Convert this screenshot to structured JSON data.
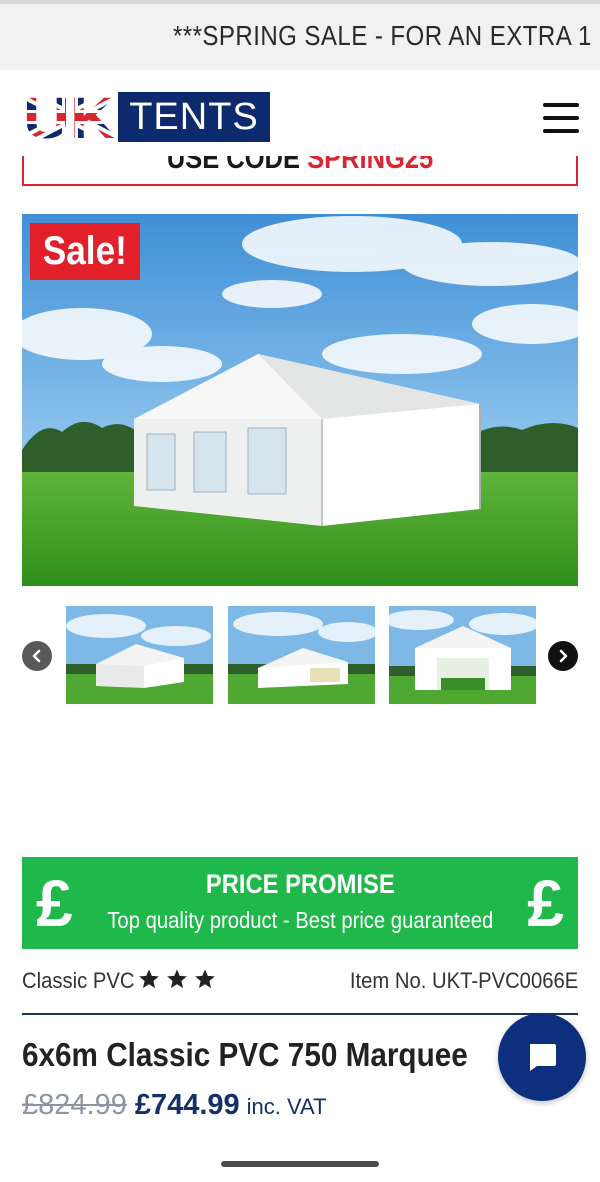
{
  "banner": {
    "text": "***SPRING SALE - FOR AN EXTRA 1"
  },
  "header": {
    "logo_uk": "UK",
    "logo_tents": "TENTS",
    "menu_icon": "hamburger-menu-icon"
  },
  "promo_code": {
    "prefix": "USE CODE ",
    "code": "SPRING25"
  },
  "gallery": {
    "sale_badge": "Sale!",
    "prev_icon": "chevron-left-icon",
    "next_icon": "chevron-right-icon",
    "thumbnail_count": 3
  },
  "price_promise": {
    "symbol": "£",
    "title": "PRICE PROMISE",
    "subtitle": "Top quality product - Best price guaranteed"
  },
  "product": {
    "range": "Classic PVC",
    "stars": 3,
    "item_number": "Item No. UKT-PVC0066E",
    "title": "6x6m Classic PVC 750 Marquee",
    "old_price": "£824.99",
    "price": "£744.99",
    "vat_note": "inc. VAT"
  },
  "colors": {
    "brand_navy": "#0d2a6e",
    "sale_red": "#e1202a",
    "promise_green": "#1fb84a",
    "price_navy": "#14306a"
  },
  "chat": {
    "icon": "chat-bubble-icon"
  }
}
